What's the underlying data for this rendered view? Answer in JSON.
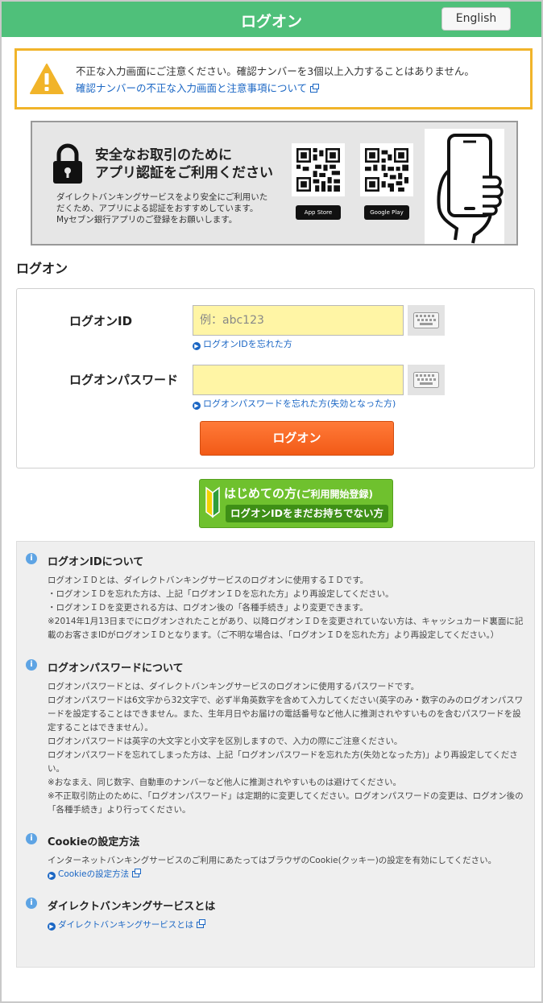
{
  "header": {
    "title": "ログオン",
    "english_label": "English"
  },
  "warning": {
    "text": "不正な入力画面にご注意ください。確認ナンバーを3個以上入力することはありません。",
    "link": "確認ナンバーの不正な入力画面と注意事項について"
  },
  "banner": {
    "title_line1": "安全なお取引のために",
    "title_line2": "アプリ認証をご利用ください",
    "desc_line1": "ダイレクトバンキングサービスをより安全にご利用いた",
    "desc_line2": "だくため、アプリによる認証をおすすめしています。",
    "desc_line3": "Myセブン銀行アプリのご登録をお願いします。",
    "appstore": "App Store",
    "googleplay": "Google Play"
  },
  "logon": {
    "section_title": "ログオン",
    "id_label": "ログオンID",
    "id_placeholder": "例：abc123",
    "id_forgot": "ログオンIDを忘れた方",
    "pw_label": "ログオンパスワード",
    "pw_forgot": "ログオンパスワードを忘れた方(失効となった方)",
    "submit": "ログオン"
  },
  "register": {
    "title": "はじめての方",
    "title_small": "(ご利用開始登録)",
    "sub": "ログオンIDをまだお持ちでない方"
  },
  "info": {
    "id_title": "ログオンIDについて",
    "id_l1": "ログオンＩＤとは、ダイレクトバンキングサービスのログオンに使用するＩＤです。",
    "id_l2": "・ログオンＩＤを忘れた方は、上記「ログオンＩＤを忘れた方」より再設定してください。",
    "id_l3": "・ログオンＩＤを変更される方は、ログオン後の「各種手続き」より変更できます。",
    "id_l4": "※2014年1月13日までにログオンされたことがあり、以降ログオンＩＤを変更されていない方は、キャッシュカード裏面に記載のお客さまIDがログオンＩＤとなります。（ご不明な場合は、「ログオンＩＤを忘れた方」より再設定してください。）",
    "pw_title": "ログオンパスワードについて",
    "pw_l1": "ログオンパスワードとは、ダイレクトバンキングサービスのログオンに使用するパスワードです。",
    "pw_l2": "ログオンパスワードは6文字から32文字で、必ず半角英数字を含めて入力してください(英字のみ・数字のみのログオンパスワードを設定することはできません。また、生年月日やお届けの電話番号など他人に推測されやすいものを含むパスワードを設定することはできません）。",
    "pw_l3": "ログオンパスワードは英字の大文字と小文字を区別しますので、入力の際にご注意ください。",
    "pw_l4": "ログオンパスワードを忘れてしまった方は、上記「ログオンパスワードを忘れた方(失効となった方)」より再設定してください。",
    "pw_l5": "※おなまえ、同じ数字、自動車のナンバーなど他人に推測されやすいものは避けてください。",
    "pw_l6": "※不正取引防止のために、「ログオンパスワード」は定期的に変更してください。ログオンパスワードの変更は、ログオン後の「各種手続き」より行ってください。",
    "cookie_title": "Cookieの設定方法",
    "cookie_l1": "インターネットバンキングサービスのご利用にあたってはブラウザのCookie(クッキー)の設定を有効にしてください。",
    "cookie_link": "Cookieの設定方法",
    "db_title": "ダイレクトバンキングサービスとは",
    "db_link": "ダイレクトバンキングサービスとは"
  },
  "colors": {
    "header": "#4fc07a",
    "warning_border": "#f1b42a",
    "logon_button": "#f25a17",
    "register_button": "#6fc12e",
    "input_bg": "#fff5a5",
    "link": "#1a66c4"
  }
}
